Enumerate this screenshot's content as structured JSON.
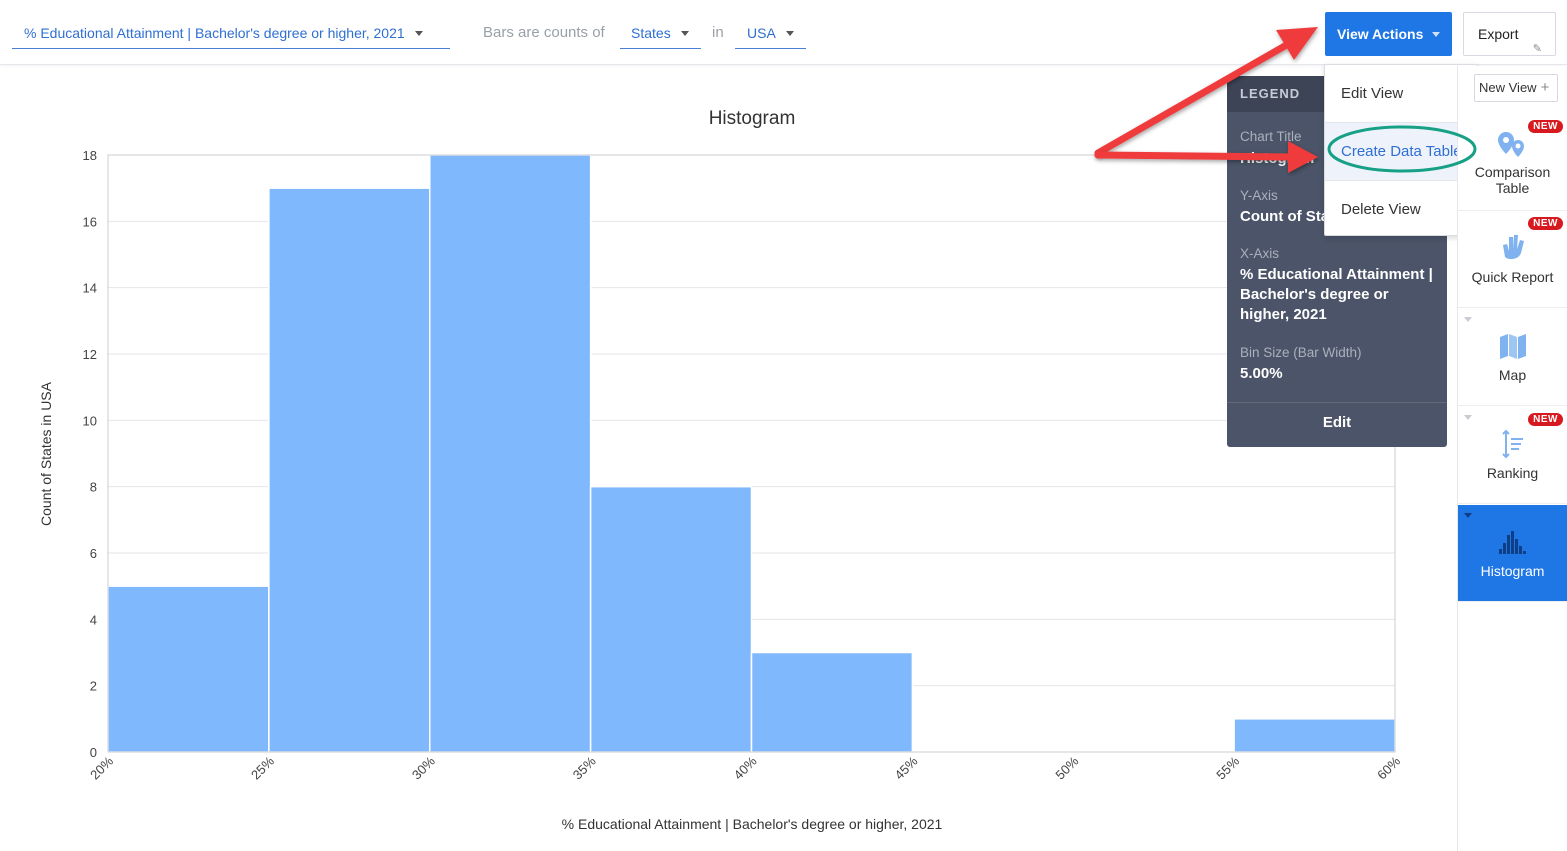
{
  "toolbar": {
    "variable_label": "% Educational Attainment | Bachelor's degree or higher, 2021",
    "bars_are_counts_of": "Bars are counts of",
    "geo_type": "States",
    "in_label": "in",
    "region": "USA",
    "view_actions": "View Actions",
    "export": "Export"
  },
  "menu": {
    "items": [
      "Edit View",
      "Create Data Table",
      "Delete View"
    ]
  },
  "legend": {
    "header": "LEGEND",
    "chart_title_label": "Chart Title",
    "chart_title_value": "Histogram",
    "y_axis_label": "Y-Axis",
    "y_axis_value": "Count of States in USA",
    "x_axis_label": "X-Axis",
    "x_axis_value": "% Educational Attainment | Bachelor's degree or higher, 2021",
    "bin_size_label": "Bin Size (Bar Width)",
    "bin_size_value": "5.00%",
    "edit": "Edit"
  },
  "side_panel": {
    "new_view": "New View",
    "tiles": [
      {
        "name": "Comparison Table",
        "badge": "NEW",
        "icon": "comparison-table-icon"
      },
      {
        "name": "Quick Report",
        "badge": "NEW",
        "icon": "quick-report-icon"
      },
      {
        "name": "Map",
        "badge": "",
        "icon": "map-icon"
      },
      {
        "name": "Ranking",
        "badge": "NEW",
        "icon": "ranking-icon"
      },
      {
        "name": "Histogram",
        "badge": "",
        "icon": "histogram-icon",
        "active": true
      }
    ]
  },
  "colors": {
    "accent": "#1f76e5",
    "bar": "#80b8fd",
    "badge": "#d71920",
    "annotation_arrow": "#ef3b3b",
    "annotation_circle": "#16a085"
  },
  "chart_data": {
    "type": "bar",
    "title": "Histogram",
    "xlabel": "% Educational Attainment | Bachelor's degree or higher, 2021",
    "ylabel": "Count of States in USA",
    "bins": [
      {
        "from": 20,
        "to": 25,
        "count": 5
      },
      {
        "from": 25,
        "to": 30,
        "count": 17
      },
      {
        "from": 30,
        "to": 35,
        "count": 18
      },
      {
        "from": 35,
        "to": 40,
        "count": 8
      },
      {
        "from": 40,
        "to": 45,
        "count": 3
      },
      {
        "from": 45,
        "to": 50,
        "count": 0
      },
      {
        "from": 50,
        "to": 55,
        "count": 0
      },
      {
        "from": 55,
        "to": 60,
        "count": 1
      }
    ],
    "x_ticks": [
      "20%",
      "25%",
      "30%",
      "35%",
      "40%",
      "45%",
      "50%",
      "55%",
      "60%"
    ],
    "y_ticks": [
      "0",
      "2",
      "4",
      "6",
      "8",
      "10",
      "12",
      "14",
      "16",
      "18"
    ],
    "xlim": [
      20,
      60
    ],
    "ylim": [
      0,
      18
    ],
    "grid": true
  }
}
